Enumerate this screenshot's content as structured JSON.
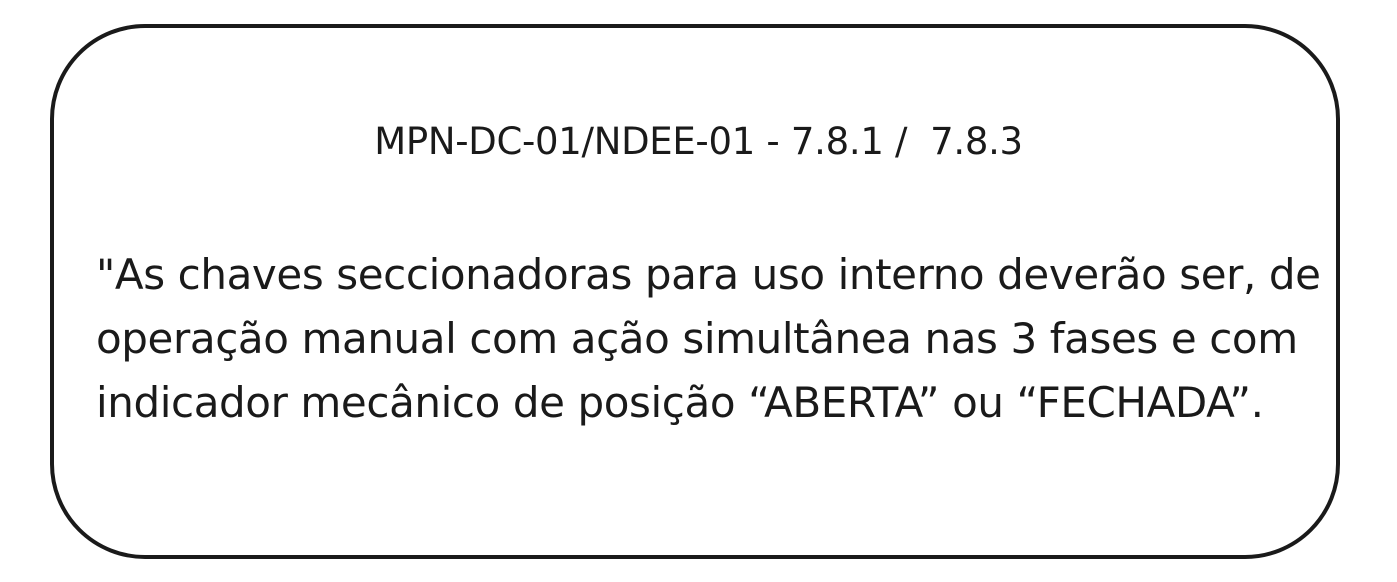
{
  "document": {
    "reference": "MPN-DC-01/NDEE-01 - 7.8.1 /  7.8.3",
    "quote_lines": [
      "\"As chaves seccionadoras para uso interno deverão ser, de",
      "operação manual com ação simultânea nas 3 fases e com",
      "indicador mecânico de posição “ABERTA” ou “FECHADA”."
    ]
  },
  "colors": {
    "border": "#1a1a1a",
    "text": "#1a1a1a",
    "background": "#ffffff"
  }
}
